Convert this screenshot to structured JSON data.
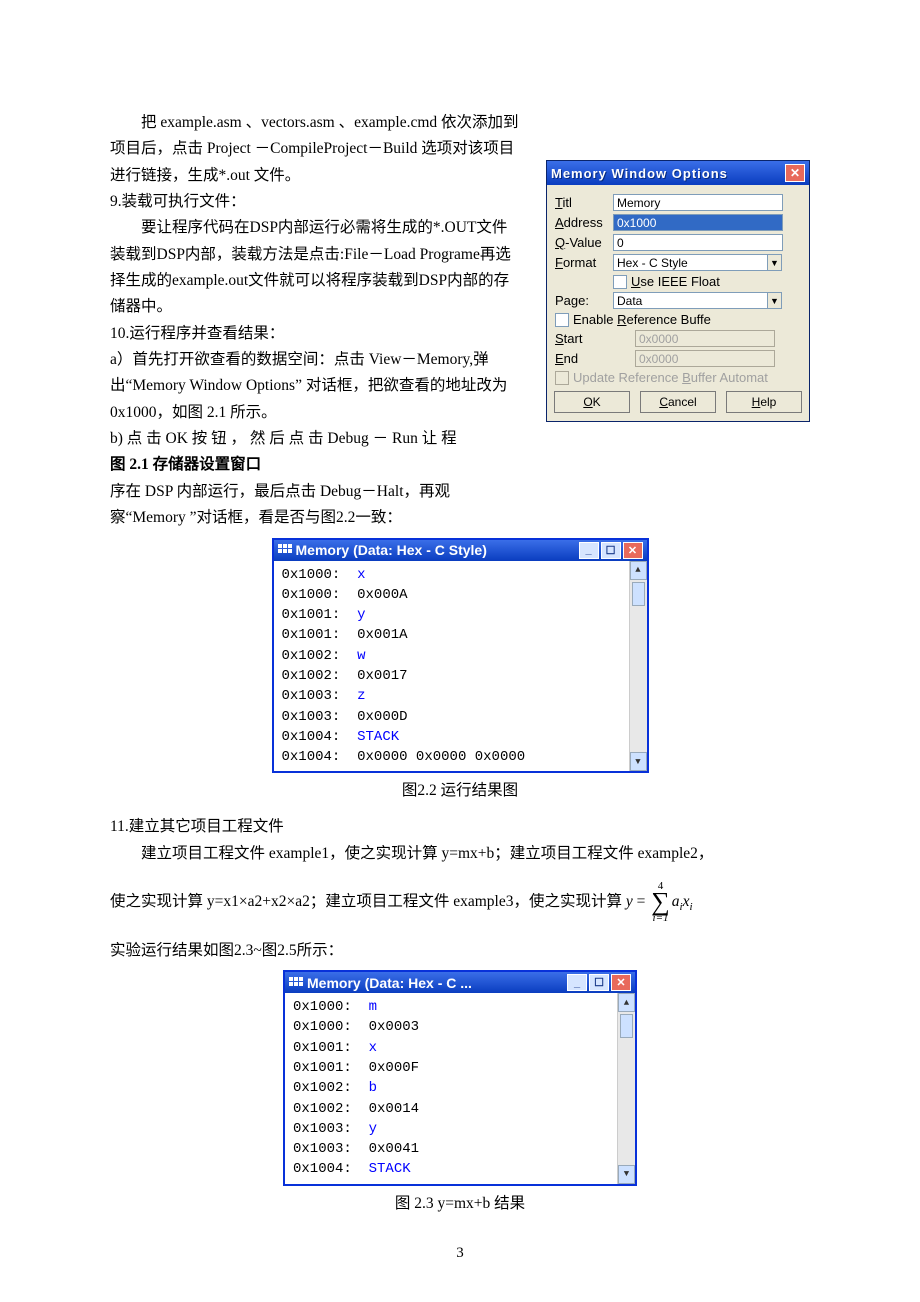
{
  "body": {
    "p1": "把 example.asm 、vectors.asm 、example.cmd 依次添加到项目后，点击 Project －CompileProject－Build 选项对该项目进行链接，生成*.out 文件。",
    "s9": "9.装载可执行文件：",
    "p2": "要让程序代码在DSP内部运行必需将生成的*.OUT文件装载到DSP内部，装载方法是点击:File－Load Programe再选择生成的example.out文件就可以将程序装载到DSP内部的存储器中。",
    "s10": "10.运行程序并查看结果：",
    "p3a": "a）首先打开欲查看的数据空间：点击 View－Memory,弹出“Memory Window Options” 对话框，把欲查看的地址改为 0x1000，如图 2.1 所示。",
    "p3b": "b) 点 击  OK 按 钮 ， 然 后 点 击  Debug － Run  让 程",
    "fig21": "图 2.1 存储器设置窗口",
    "p4": "序在 DSP 内部运行，最后点击 Debug－Halt，再观察“Memory ”对话框，看是否与图2.2一致：",
    "fig22": "图2.2 运行结果图",
    "s11": "11.建立其它项目工程文件",
    "p5": "建立项目工程文件 example1，使之实现计算 y=mx+b；建立项目工程文件 example2，",
    "p6a": "使之实现计算 y=x1×a2+x2×a2；建立项目工程文件 example3，使之实现计算 ",
    "p7": "实验运行结果如图2.3~图2.5所示：",
    "fig23": "图 2.3 y=mx+b 结果"
  },
  "opt": {
    "title": "Memory Window Options",
    "titl_lbl": "Titl",
    "titl_val": "Memory",
    "addr_lbl": "Address",
    "addr_val": "0x1000",
    "qval_lbl": "Q-Value",
    "qval_val": "0",
    "fmt_lbl": "Format",
    "fmt_val": "Hex - C Style",
    "ieee": "Use IEEE Float",
    "page_lbl": "Page:",
    "page_val": "Data",
    "enable_ref": "Enable Reference Buffe",
    "start_lbl": "Start",
    "start_val": "0x0000",
    "end_lbl": "End",
    "end_val": "0x0000",
    "update": "Update Reference Buffer Automat",
    "ok": "OK",
    "cancel": "Cancel",
    "help": "Help"
  },
  "mem1": {
    "title": "Memory (Data: Hex - C Style)",
    "rows": [
      {
        "addr": "0x1000:",
        "val": "x",
        "c": "b"
      },
      {
        "addr": "0x1000:",
        "val": "0x000A",
        "c": "k"
      },
      {
        "addr": "0x1001:",
        "val": "y",
        "c": "b"
      },
      {
        "addr": "0x1001:",
        "val": "0x001A",
        "c": "k"
      },
      {
        "addr": "0x1002:",
        "val": "w",
        "c": "b"
      },
      {
        "addr": "0x1002:",
        "val": "0x0017",
        "c": "k"
      },
      {
        "addr": "0x1003:",
        "val": "z",
        "c": "b"
      },
      {
        "addr": "0x1003:",
        "val": "0x000D",
        "c": "k"
      },
      {
        "addr": "0x1004:",
        "val": "STACK",
        "c": "b"
      },
      {
        "addr": "0x1004:",
        "val": "0x0000 0x0000 0x0000",
        "c": "k"
      }
    ]
  },
  "mem2": {
    "title": "Memory (Data: Hex - C ...",
    "rows": [
      {
        "addr": "0x1000:",
        "val": "m",
        "c": "b"
      },
      {
        "addr": "0x1000:",
        "val": "0x0003",
        "c": "k"
      },
      {
        "addr": "0x1001:",
        "val": "x",
        "c": "b"
      },
      {
        "addr": "0x1001:",
        "val": "0x000F",
        "c": "k"
      },
      {
        "addr": "0x1002:",
        "val": "b",
        "c": "b"
      },
      {
        "addr": "0x1002:",
        "val": "0x0014",
        "c": "k"
      },
      {
        "addr": "0x1003:",
        "val": "y",
        "c": "b"
      },
      {
        "addr": "0x1003:",
        "val": "0x0041",
        "c": "k"
      },
      {
        "addr": "0x1004:",
        "val": "STACK",
        "c": "b"
      }
    ]
  },
  "math": {
    "y": "y",
    "eq": " = ",
    "top": "4",
    "bot": "i=1",
    "a": "a",
    "x": "x",
    "i": "i"
  },
  "page_num": "3"
}
